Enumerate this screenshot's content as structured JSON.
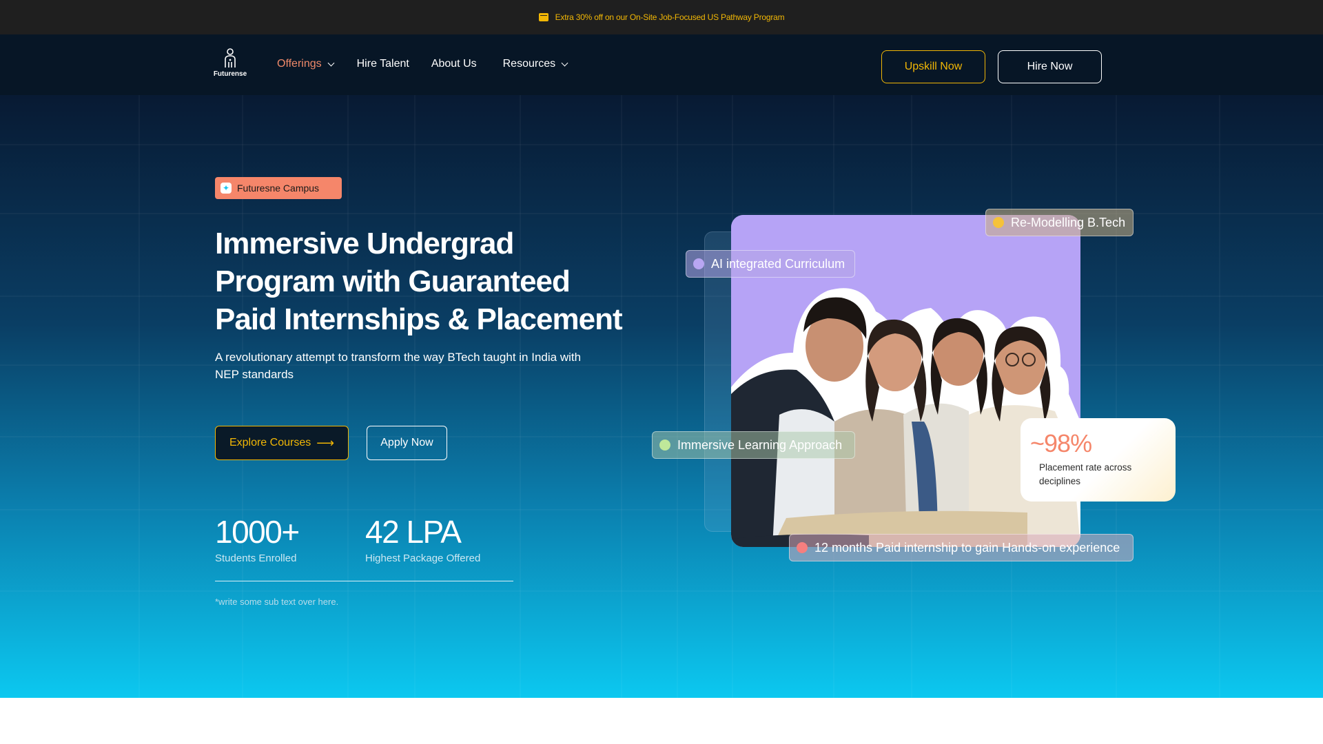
{
  "announcement": {
    "icon": "gift-icon",
    "text": "Extra 30% off on our On-Site Job-Focused US Pathway Program",
    "color": "#f2b705"
  },
  "nav": {
    "logo_text": "Futurense",
    "links": [
      {
        "label": "Offerings",
        "active": true,
        "has_dropdown": true
      },
      {
        "label": "Hire Talent",
        "active": false,
        "has_dropdown": false
      },
      {
        "label": "About Us",
        "active": false,
        "has_dropdown": false
      },
      {
        "label": "Resources",
        "active": false,
        "has_dropdown": true
      }
    ],
    "upskill_label": "Upskill Now",
    "hire_label": "Hire Now"
  },
  "hero": {
    "badge": "Futuresne Campus",
    "headline_lines": [
      "Immersive Undergrad",
      "Program with Guaranteed",
      "Paid Internships & Placement"
    ],
    "subtext": "A revolutionary attempt to transform the way BTech taught in India with NEP standards",
    "explore_label": "Explore Courses",
    "apply_label": "Apply Now",
    "stats": [
      {
        "value": "1000+",
        "label": "Students Enrolled"
      },
      {
        "value": "42 LPA",
        "label": "Highest Package Offered"
      }
    ],
    "footnote": "*write some sub text over here."
  },
  "visual": {
    "chips": {
      "remodel": "Re-Modelling B.Tech",
      "ai": "AI integrated Curriculum",
      "immersive": "Immersive  Learning Approach",
      "internship": "12 months Paid internship to gain Hands-on experience"
    },
    "chip_colors": {
      "remodel": "#f5c23a",
      "ai": "#b8a6f2",
      "immersive": "#bfe89a",
      "internship": "#f57f7f"
    },
    "placement": {
      "value": "~98%",
      "label": "Placement rate across deciplines"
    }
  },
  "colors": {
    "accent": "#f2b705",
    "coral": "#f5866a",
    "nav_bg": "#071626",
    "announce_bg": "#1f1f1f"
  }
}
